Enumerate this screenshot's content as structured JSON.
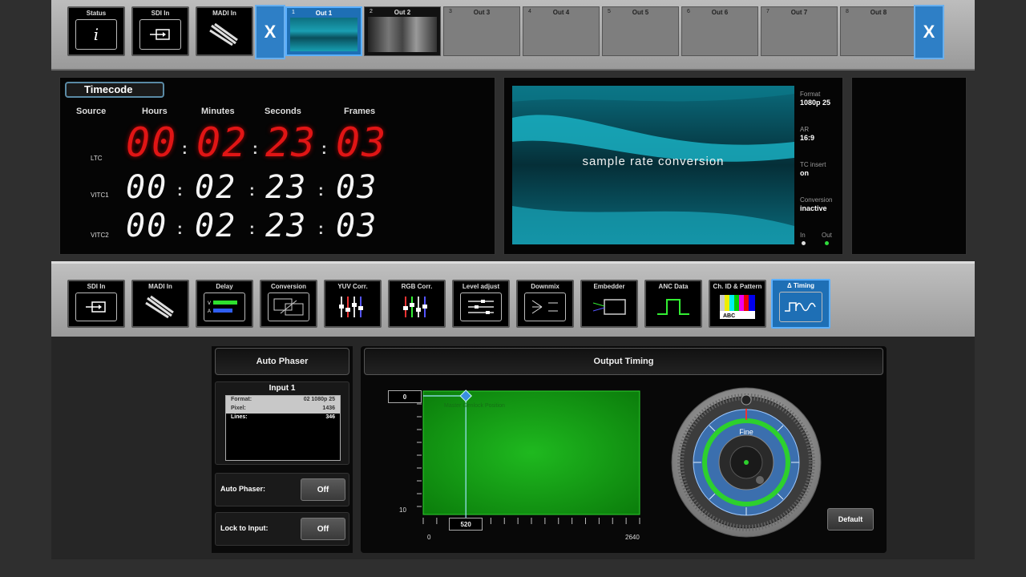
{
  "top_tiles": [
    {
      "label": "Status",
      "icon": "info-icon"
    },
    {
      "label": "SDI In",
      "icon": "sdi-input-icon"
    },
    {
      "label": "MADI In",
      "icon": "madi-cable-icon"
    }
  ],
  "outputs": [
    {
      "num": "1",
      "label": "Out 1",
      "active": true
    },
    {
      "num": "2",
      "label": "Out 2",
      "active": false
    },
    {
      "num": "3",
      "label": "Out 3",
      "active": false
    },
    {
      "num": "4",
      "label": "Out 4",
      "active": false
    },
    {
      "num": "5",
      "label": "Out 5",
      "active": false
    },
    {
      "num": "6",
      "label": "Out 6",
      "active": false
    },
    {
      "num": "7",
      "label": "Out 7",
      "active": false
    },
    {
      "num": "8",
      "label": "Out 8",
      "active": false
    }
  ],
  "close_label": "X",
  "timecode": {
    "title": "Timecode",
    "headers": {
      "source": "Source",
      "hours": "Hours",
      "minutes": "Minutes",
      "seconds": "Seconds",
      "frames": "Frames"
    },
    "rows": [
      {
        "label": "LTC",
        "h": "00",
        "m": "02",
        "s": "23",
        "f": "03"
      },
      {
        "label": "VITC1",
        "h": "00",
        "m": "02",
        "s": "23",
        "f": "03"
      },
      {
        "label": "VITC2",
        "h": "00",
        "m": "02",
        "s": "23",
        "f": "03"
      }
    ]
  },
  "preview": {
    "caption": "sample rate conversion",
    "format_k": "Format",
    "format_v": "1080p 25",
    "ar_k": "AR",
    "ar_v": "16:9",
    "tc_k": "TC insert",
    "tc_v": "on",
    "conv_k": "Conversion",
    "conv_v": "inactive",
    "in_k": "In",
    "out_k": "Out"
  },
  "bottom_tiles": [
    {
      "label": "SDI In",
      "icon": "sdi-input-icon"
    },
    {
      "label": "MADI In",
      "icon": "madi-cable-icon"
    },
    {
      "label": "Delay",
      "icon": "delay-bars-icon"
    },
    {
      "label": "Conversion",
      "icon": "conversion-icon"
    },
    {
      "label": "YUV Corr.",
      "icon": "yuv-sliders-icon"
    },
    {
      "label": "RGB Corr.",
      "icon": "rgb-sliders-icon"
    },
    {
      "label": "Level adjust",
      "icon": "level-adjust-icon"
    },
    {
      "label": "Downmix",
      "icon": "downmix-icon"
    },
    {
      "label": "Embedder",
      "icon": "embedder-icon"
    },
    {
      "label": "ANC Data",
      "icon": "anc-data-icon"
    },
    {
      "label": "Ch. ID & Pattern",
      "icon": "test-pattern-icon"
    },
    {
      "label": "Δ Timing",
      "icon": "timing-icon"
    }
  ],
  "auto_phaser": {
    "title": "Auto Phaser",
    "input_title": "Input 1",
    "rows": [
      {
        "k": "Format:",
        "v": "02 1080p 25"
      },
      {
        "k": "Pixel:",
        "v": "1436"
      },
      {
        "k": "Lines:",
        "v": "346"
      }
    ],
    "auto_phaser_label": "Auto Phaser:",
    "auto_phaser_value": "Off",
    "lock_label": "Lock to Input:",
    "lock_value": "Off"
  },
  "output_timing": {
    "title": "Output Timing",
    "y_value": "0",
    "x_value": "520",
    "y_bottom": "10",
    "x_min": "0",
    "x_max": "2640",
    "graph_caption": "Master Genlock Position",
    "dial_label": "Fine",
    "default_label": "Default",
    "x_position": 520,
    "x_range": [
      0,
      2640
    ],
    "y_position": 0,
    "y_range": [
      0,
      10
    ]
  }
}
